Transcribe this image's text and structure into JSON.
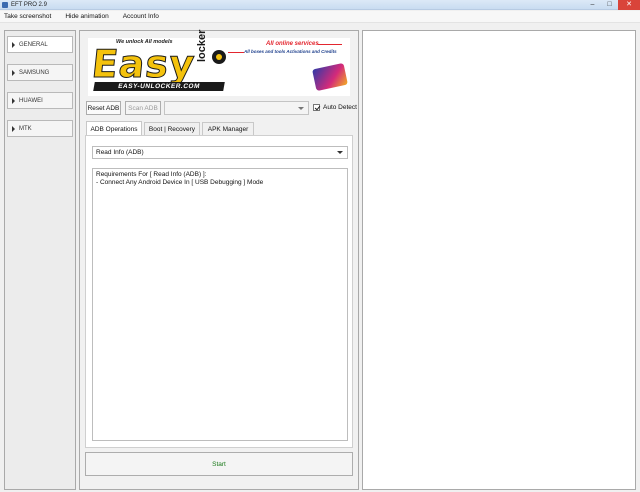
{
  "window": {
    "title": "EFT PRO 2.9",
    "minimize": "–",
    "maximize": "□",
    "close": "✕"
  },
  "menu": [
    "Take screenshot",
    "Hide animation",
    "Account Info"
  ],
  "sidebar": {
    "items": [
      {
        "label": "GENERAL",
        "active": true
      },
      {
        "label": "SAMSUNG",
        "active": false
      },
      {
        "label": "HUAWEI",
        "active": false
      },
      {
        "label": "MTK",
        "active": false
      }
    ]
  },
  "banner": {
    "tagline": "We unlock All models",
    "logo": "Easy",
    "logo_sub": "locker",
    "domain": "EASY-UNLOCKER.COM",
    "services_title": "All online services",
    "services_sub": "All boxes and tools Activations and Credits"
  },
  "adb": {
    "reset_label": "Reset ADB",
    "scan_label": "Scan ADB",
    "device_value": "",
    "auto_detect_label": "Auto Detect",
    "auto_detect_checked": true
  },
  "tabs": [
    {
      "label": "ADB Operations",
      "active": true
    },
    {
      "label": "Boot | Recovery",
      "active": false
    },
    {
      "label": "APK Manager",
      "active": false
    }
  ],
  "operation": {
    "selected": "Read Info (ADB)",
    "requirements_title": "Requirements For [ Read Info (ADB) ]:",
    "requirements_line1": "- Connect Any Android Device In [ USB Debugging ] Mode"
  },
  "start_label": "Start"
}
